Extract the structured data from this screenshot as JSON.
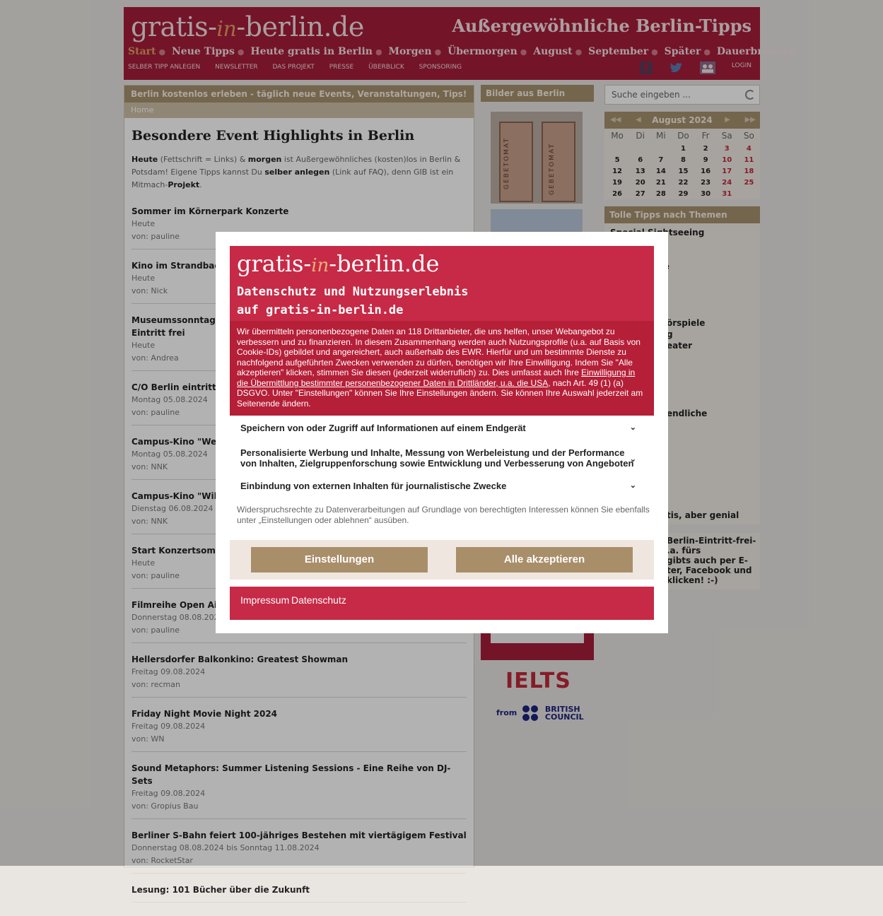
{
  "header": {
    "logo_pre": "gratis-",
    "logo_in": "in",
    "logo_post": "-berlin.de",
    "slogan": "Außergewöhnliche Berlin-Tipps",
    "main_nav": [
      "Start",
      "Neue Tipps",
      "Heute gratis in Berlin",
      "Morgen",
      "Übermorgen",
      "August",
      "September",
      "Später",
      "Dauerbrenner"
    ],
    "sub_nav": [
      "SELBER TIPP ANLEGEN",
      "NEWSLETTER",
      "DAS PROJEKT",
      "PRESSE",
      "ÜBERBLICK",
      "SPONSORING"
    ],
    "social_icons": [
      "facebook-icon",
      "twitter-icon",
      "community-icon"
    ],
    "login": "LOGIN"
  },
  "main": {
    "banner": "Berlin kostenlos erleben - täglich neue Events, Veranstaltungen, Tips!",
    "breadcrumb": "Home",
    "title": "Besondere Event Highlights in Berlin",
    "intro": {
      "p1": "Heute",
      "p2": " (Fettschrift = Links) & ",
      "p3": "morgen",
      "p4": " ist Außergewöhnliches (kosten)los in Berlin & Potsdam! Eigene Tipps kannst Du ",
      "p5": "selber anlegen",
      "p6": " (Link auf FAQ), denn GIB ist ein Mitmach-",
      "p7": "Projekt",
      "p8": "."
    },
    "events": [
      {
        "title": "Sommer im Körnerpark Konzerte",
        "date": "Heute",
        "by": "von: pauline"
      },
      {
        "title": "Kino im Strandbad",
        "date": "Heute",
        "by": "von: Nick"
      },
      {
        "title": "Museumssonntag:\nEintritt frei",
        "date": "Heute",
        "by": "von: Andrea"
      },
      {
        "title": "C/O Berlin eintritts",
        "date": "Montag 05.08.2024",
        "by": "von: pauline"
      },
      {
        "title": "Campus-Kino \"We",
        "date": "Montag 05.08.2024",
        "by": "von: NNK"
      },
      {
        "title": "Campus-Kino \"Wil",
        "date": "Dienstag 06.08.2024",
        "by": "von: NNK"
      },
      {
        "title": "Start Konzertsomm",
        "date": "Heute",
        "by": "von: pauline"
      },
      {
        "title": "Filmreihe Open Air",
        "date": "Donnerstag 08.08.2024",
        "by": "von: pauline"
      },
      {
        "title": "Hellersdorfer Balkonkino: Greatest Showman",
        "date": "Freitag 09.08.2024",
        "by": "von: recman"
      },
      {
        "title": "Friday Night Movie Night 2024",
        "date": "Freitag 09.08.2024",
        "by": "von: WN"
      },
      {
        "title": "Sound Metaphors: Summer Listening Sessions - Eine Reihe von DJ-Sets",
        "date": "Freitag 09.08.2024",
        "by": "von: Gropius Bau"
      },
      {
        "title": "Berliner S-Bahn feiert 100-jähriges Bestehen mit viertägigem Festival",
        "date": "Donnerstag 08.08.2024 bis Sonntag 11.08.2024",
        "by": "von: RocketStar"
      },
      {
        "title": "Lesung: 101 Bücher über die Zukunft",
        "date": "",
        "by": ""
      }
    ]
  },
  "middle": {
    "heading": "Bilder aus Berlin",
    "photo_label": "GEBETOMAT",
    "ielts": "IELTS",
    "bc_from": "from",
    "bc_line1": "BRITISH",
    "bc_line2": "COUNCIL"
  },
  "sidebar": {
    "search_placeholder": "Suche eingeben ...",
    "calendar": {
      "month": "August 2024",
      "weekdays": [
        "Mo",
        "Di",
        "Mi",
        "Do",
        "Fr",
        "Sa",
        "So"
      ],
      "weeks": [
        [
          "",
          "",
          "",
          "1",
          "2",
          "3",
          "4"
        ],
        [
          "5",
          "6",
          "7",
          "8",
          "9",
          "10",
          "11"
        ],
        [
          "12",
          "13",
          "14",
          "15",
          "16",
          "17",
          "18"
        ],
        [
          "19",
          "20",
          "21",
          "22",
          "23",
          "24",
          "25"
        ],
        [
          "26",
          "27",
          "28",
          "29",
          "30",
          "31",
          ""
        ]
      ]
    },
    "topics_heading": "Tolle Tipps nach Themen",
    "topics": [
      "Special Sightseeing",
      "kte",
      "örspiele",
      "g",
      "eater",
      "endliche",
      "tis, aber genial"
    ],
    "fb_text": [
      "Berlin-Eintritt-frei-",
      ".a. fürs",
      "gibts auch per E-",
      "ter, Facebook und",
      "klicken! :-)"
    ]
  },
  "consent": {
    "logo_pre": "gratis-",
    "logo_in": "in",
    "logo_post": "-berlin.de",
    "title_line1": "Datenschutz und Nutzungserlebnis",
    "title_line2": "auf gratis-in-berlin.de",
    "body_a": "Wir übermitteln personenbezogene Daten an 118 Drittanbieter, die uns helfen, unser Webangebot zu verbessern und zu finanzieren. In diesem Zusammenhang werden auch Nutzungsprofile (u.a. auf Basis von Cookie-IDs) gebildet und angereichert, auch außerhalb des EWR. Hierfür und um bestimmte Dienste zu nachfolgend aufgeführten Zwecken verwenden zu dürfen, benötigen wir Ihre Einwilligung. Indem Sie \"Alle akzeptieren\" klicken, stimmen Sie diesen (jederzeit widerruflich) zu. Dies umfasst auch Ihre ",
    "body_link": "Einwilligung in die Übermittlung bestimmter personenbezogener Daten in Drittländer, u.a. die USA",
    "body_b": ", nach Art. 49 (1) (a) DSGVO. Unter \"Einstellungen\" können Sie Ihre Einstellungen ändern. Sie können Ihre Auswahl jederzeit am Seitenende ändern.",
    "purposes": [
      "Speichern von oder Zugriff auf Informationen auf einem Endgerät",
      "Personalisierte Werbung und Inhalte, Messung von Werbeleistung und der Performance von Inhalten, Zielgruppenforschung sowie Entwicklung und Verbesserung von Angeboten",
      "Einbindung von externen Inhalten für journalistische Zwecke"
    ],
    "note": "Widerspruchsrechte zu Datenverarbeitungen auf Grundlage von berechtigten Interessen können Sie ebenfalls unter „Einstellungen oder ablehnen“ ausüben.",
    "settings_button": "Einstellungen",
    "accept_button": "Alle akzeptieren",
    "impressum": "Impressum",
    "datenschutz": "Datenschutz"
  },
  "colors": {
    "brand": "#a61e3a",
    "modal_red": "#c72a46",
    "tan": "#a6916f",
    "button": "#a98e6a"
  }
}
